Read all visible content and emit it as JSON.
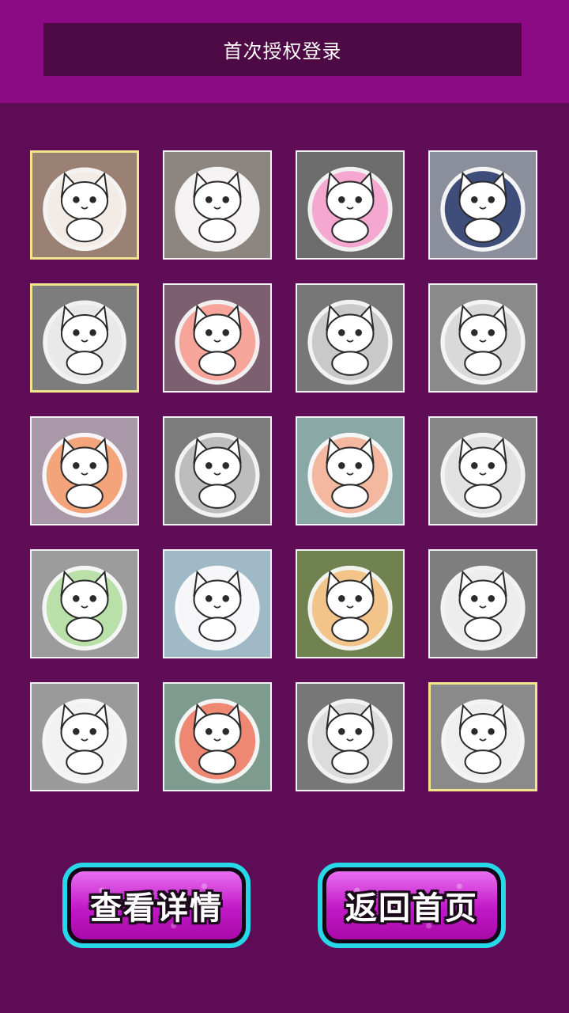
{
  "header": {
    "login_label": "首次授权登录"
  },
  "grid": {
    "tiles": [
      {
        "name": "white-cat-in-cup-sticker",
        "bg": "#9b8074",
        "accent": "#f3ece6",
        "selected": true
      },
      {
        "name": "calico-kitten-sticker",
        "bg": "#8d8580",
        "accent": "#f7f3f4",
        "selected": false
      },
      {
        "name": "pink-cat-sticker",
        "bg": "#6c6c6c",
        "accent": "#f4a7cf",
        "selected": false
      },
      {
        "name": "girl-with-black-cat-sticker",
        "bg": "#8a8f9b",
        "accent": "#3f4d7a",
        "selected": false
      },
      {
        "name": "girl-with-white-cat-sticker",
        "bg": "#7d7d7d",
        "accent": "#e9e9e9",
        "selected": true
      },
      {
        "name": "girl-cats-moon-sticker",
        "bg": "#7c6070",
        "accent": "#f7a59a",
        "selected": false
      },
      {
        "name": "sleeping-cats-sticker",
        "bg": "#777777",
        "accent": "#c9c9c9",
        "selected": false
      },
      {
        "name": "sleeping-girl-cat-sticker",
        "bg": "#8a8a8a",
        "accent": "#d9d9d9",
        "selected": false
      },
      {
        "name": "black-and-white-cats-sticker",
        "bg": "#a898a8",
        "accent": "#f3a47a",
        "selected": false
      },
      {
        "name": "grey-cat-butterfly-sticker",
        "bg": "#7c7c7c",
        "accent": "#bdbdbd",
        "selected": false
      },
      {
        "name": "white-cat-teacup-sticker",
        "bg": "#8aa8a6",
        "accent": "#f4b8a0",
        "selected": false
      },
      {
        "name": "cat-reading-book-sticker",
        "bg": "#878787",
        "accent": "#e2e2e2",
        "selected": false
      },
      {
        "name": "music-cat-sticker",
        "bg": "#9c9c9c",
        "accent": "#b9e0a8",
        "selected": false
      },
      {
        "name": "blue-eyed-cat-sticker",
        "bg": "#9fb9c6",
        "accent": "#f6f6f8",
        "selected": false
      },
      {
        "name": "cat-sunset-sticker",
        "bg": "#6f8250",
        "accent": "#f2c48a",
        "selected": false
      },
      {
        "name": "cat-castle-sticker",
        "bg": "#7e7e7e",
        "accent": "#ededed",
        "selected": false
      },
      {
        "name": "cat-in-pot-sticker",
        "bg": "#9a9a9a",
        "accent": "#f2f2f2",
        "selected": false
      },
      {
        "name": "cat-flower-wreath-sticker",
        "bg": "#7d9c8f",
        "accent": "#ee8872",
        "selected": false
      },
      {
        "name": "girl-holding-cat-sticker",
        "bg": "#777777",
        "accent": "#dcdcdc",
        "selected": false
      },
      {
        "name": "dancing-girl-cats-sticker",
        "bg": "#8a8a8a",
        "accent": "#efefef",
        "selected": true
      }
    ]
  },
  "buttons": {
    "details_label": "查看详情",
    "home_label": "返回首页"
  }
}
